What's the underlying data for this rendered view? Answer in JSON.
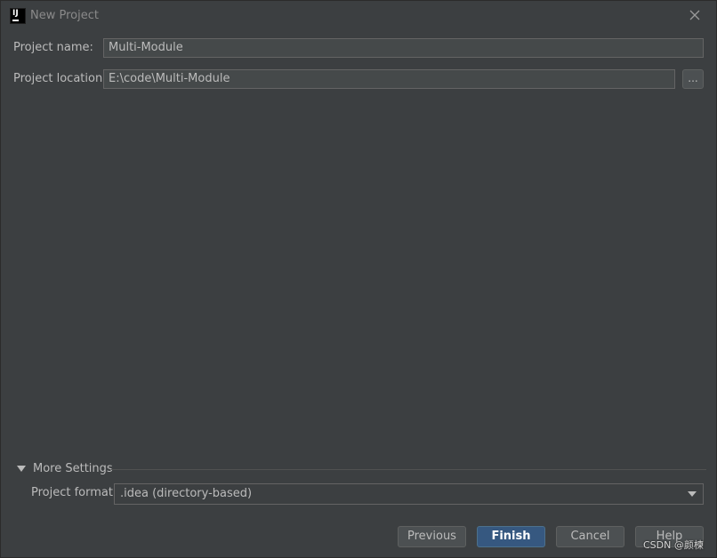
{
  "window": {
    "title": "New Project",
    "app_icon_text": "IJ"
  },
  "form": {
    "project_name_label": "Project name:",
    "project_name_value": "Multi-Module",
    "project_location_label": "Project location:",
    "project_location_value": "E:\\code\\Multi-Module",
    "browse_label": "..."
  },
  "more_settings": {
    "label": "More Settings",
    "expanded": true,
    "project_format_label": "Project format:",
    "project_format_value": ".idea (directory-based)"
  },
  "buttons": {
    "previous": "Previous",
    "finish": "Finish",
    "cancel": "Cancel",
    "help": "Help"
  },
  "watermark": "CSDN @颜楝",
  "colors": {
    "background": "#3c3f41",
    "field_bg": "#45494a",
    "primary_button": "#365880",
    "text": "#bbbbbb"
  },
  "icons": {
    "app": "intellij-icon",
    "close": "close-icon",
    "expand": "triangle-down-icon",
    "dropdown": "chevron-down-icon"
  }
}
